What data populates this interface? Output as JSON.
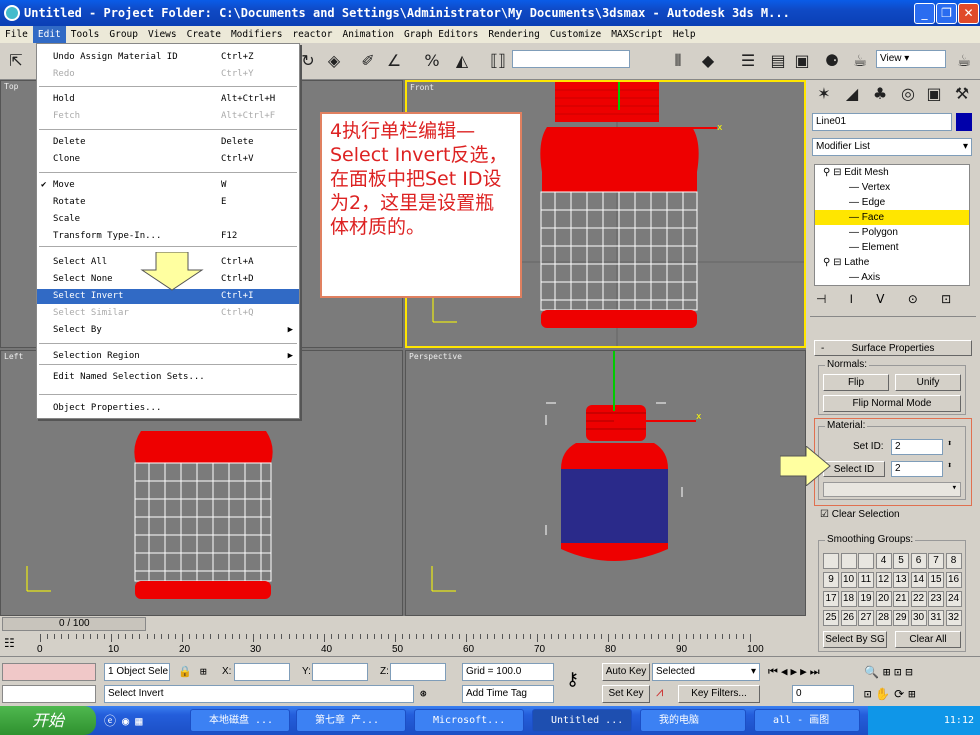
{
  "window": {
    "title": "Untitled      - Project Folder: C:\\Documents and Settings\\Administrator\\My Documents\\3dsmax     - Autodesk 3ds M...",
    "min": "_",
    "max": "❐",
    "close": "✕"
  },
  "menubar": [
    "File",
    "Edit",
    "Tools",
    "Group",
    "Views",
    "Create",
    "Modifiers",
    "reactor",
    "Animation",
    "Graph Editors",
    "Rendering",
    "Customize",
    "MAXScript",
    "Help"
  ],
  "edit_menu": {
    "items": [
      {
        "label": "Undo Assign Material ID",
        "shortcut": "Ctrl+Z",
        "disabled": false
      },
      {
        "label": "Redo",
        "shortcut": "Ctrl+Y",
        "disabled": true
      },
      {
        "label": "Hold",
        "shortcut": "Alt+Ctrl+H",
        "disabled": false
      },
      {
        "label": "Fetch",
        "shortcut": "Alt+Ctrl+F",
        "disabled": true
      },
      {
        "label": "Delete",
        "shortcut": "Delete",
        "disabled": false
      },
      {
        "label": "Clone",
        "shortcut": "Ctrl+V",
        "disabled": false
      },
      {
        "label": "Move",
        "shortcut": "W",
        "disabled": false,
        "checked": "✔"
      },
      {
        "label": "Rotate",
        "shortcut": "E",
        "disabled": false
      },
      {
        "label": "Scale",
        "shortcut": "",
        "disabled": false
      },
      {
        "label": "Transform Type-In...",
        "shortcut": "F12",
        "disabled": false
      },
      {
        "label": "Select All",
        "shortcut": "Ctrl+A",
        "disabled": false
      },
      {
        "label": "Select None",
        "shortcut": "Ctrl+D",
        "disabled": false
      },
      {
        "label": "Select Invert",
        "shortcut": "Ctrl+I",
        "disabled": false,
        "selected": true
      },
      {
        "label": "Select Similar",
        "shortcut": "Ctrl+Q",
        "disabled": true
      },
      {
        "label": "Select By",
        "shortcut": "",
        "disabled": false,
        "submenu": "▶"
      },
      {
        "label": "Selection Region",
        "shortcut": "",
        "disabled": false,
        "submenu": "▶"
      },
      {
        "label": "Edit Named Selection Sets...",
        "shortcut": "",
        "disabled": false
      },
      {
        "label": "Object Properties...",
        "shortcut": "",
        "disabled": false
      }
    ]
  },
  "annotation": "4执行单栏编辑—Select Invert反选，在面板中把Set ID设为2，这里是设置瓶体材质的。",
  "toolbar": {
    "view_select": "View"
  },
  "viewports": {
    "top": "Top",
    "front": "Front",
    "left": "Left",
    "perspective": "Perspective"
  },
  "command_panel": {
    "object_name": "Line01",
    "modifier_list": "Modifier List",
    "stack": [
      "Edit Mesh",
      "Vertex",
      "Edge",
      "Face",
      "Polygon",
      "Element",
      "Lathe",
      "Axis"
    ],
    "stack_selected": "Face",
    "rollout_title": "Surface Properties",
    "rollout_collapse": "-",
    "normals_label": "Normals:",
    "flip": "Flip",
    "unify": "Unify",
    "flip_normal_mode": "Flip Normal Mode",
    "material_label": "Material:",
    "set_id_label": "Set ID:",
    "set_id_value": "2",
    "select_id_button": "Select ID",
    "select_id_value": "2",
    "clear_selection": "Clear Selection",
    "smoothing_label": "Smoothing Groups:",
    "smoothing_cells": [
      "",
      "",
      "",
      "4",
      "5",
      "6",
      "7",
      "8",
      "9",
      "10",
      "11",
      "12",
      "13",
      "14",
      "15",
      "16",
      "17",
      "18",
      "19",
      "20",
      "21",
      "22",
      "23",
      "24",
      "25",
      "26",
      "27",
      "28",
      "29",
      "30",
      "31",
      "32"
    ],
    "select_by_sg": "Select By SG",
    "clear_all": "Clear All"
  },
  "timeline": {
    "frame": "0 / 100",
    "ticks": [
      "0",
      "10",
      "20",
      "30",
      "40",
      "50",
      "60",
      "70",
      "80",
      "90",
      "100"
    ]
  },
  "status": {
    "objects": "1 Object Sele",
    "x_label": "X:",
    "y_label": "Y:",
    "z_label": "Z:",
    "grid": "Grid = 100.0",
    "auto_key": "Auto Key",
    "selected": "Selected",
    "set_key": "Set Key",
    "key_filters": "Key Filters...",
    "frame_value": "0",
    "prompt": "Select Invert",
    "add_time_tag": "Add Time Tag"
  },
  "taskbar": {
    "start": "开始",
    "tasks": [
      "本地磁盘 ...",
      "第七章 产...",
      "Microsoft...",
      "Untitled ...",
      "我的电脑",
      "all - 画图"
    ],
    "clock": "11:12"
  },
  "colors": {
    "bottle_red": "#ee0000",
    "bottle_blue": "#2a2a8a",
    "highlight": "#316ac5",
    "stack_sel": "#ffe600"
  }
}
